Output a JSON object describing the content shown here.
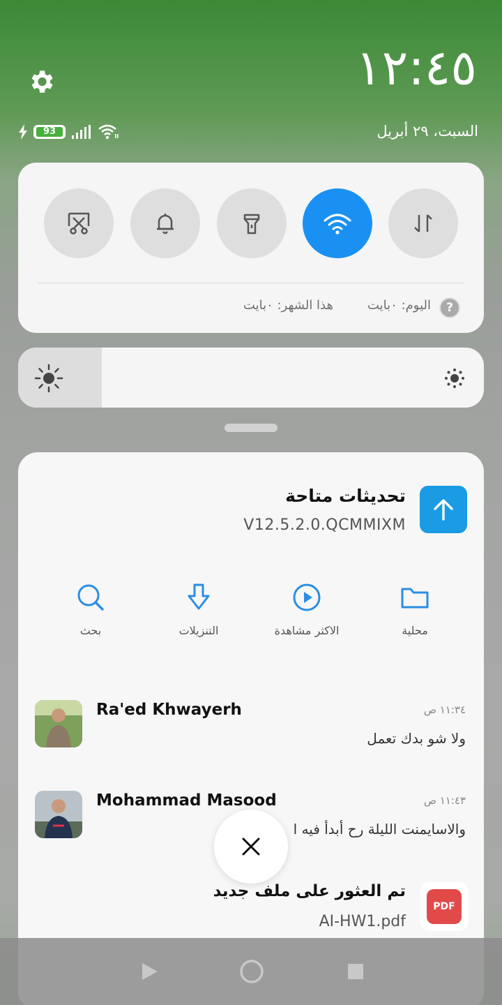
{
  "status": {
    "time": "١٢:٤٥",
    "date": "السبت، ٢٩ أبريل",
    "battery": "93"
  },
  "quick_settings": {
    "toggles": [
      {
        "name": "screenshot",
        "active": false
      },
      {
        "name": "sound",
        "active": false
      },
      {
        "name": "flashlight",
        "active": false
      },
      {
        "name": "wifi",
        "active": true
      },
      {
        "name": "mobile-data",
        "active": false
      }
    ],
    "usage_today": "اليوم: ٠بايت",
    "usage_month": "هذا الشهر: ٠بايت",
    "help": "?"
  },
  "brightness": {
    "level": 0.18
  },
  "notifications": {
    "update": {
      "title": "تحديثات متاحة",
      "version": "V12.5.2.0.QCMMIXM"
    },
    "actions": [
      {
        "label": "محلية",
        "icon": "folder-icon"
      },
      {
        "label": "الاكثر مشاهدة",
        "icon": "play-circle-icon"
      },
      {
        "label": "التنزيلات",
        "icon": "download-icon"
      },
      {
        "label": "بحث",
        "icon": "search-icon"
      }
    ],
    "messages": [
      {
        "name": "Ra'ed Khwayerh",
        "time": "١١:٣٤ ص",
        "text": "ولا شو بدك تعمل"
      },
      {
        "name": "Mohammad Masood",
        "time": "١١:٤٣ ص",
        "text": "والاسايمنت الليلة رح أبدأ فيه ا"
      }
    ],
    "file": {
      "title": "تم العثور على ملف جديد",
      "name": "AI-HW1.pdf",
      "badge": "PDF"
    }
  },
  "colors": {
    "accent": "#1a91f2",
    "update_icon": "#1a9be4",
    "pdf": "#e24a4a"
  }
}
